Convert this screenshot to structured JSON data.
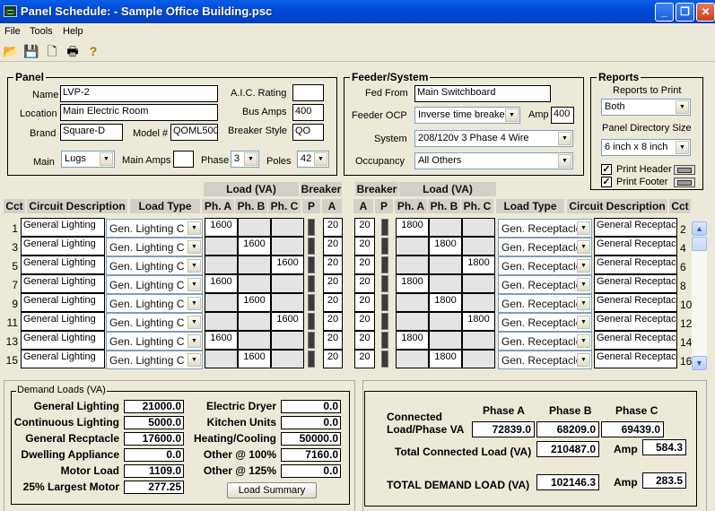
{
  "window": {
    "title": "Panel Schedule: -  Sample Office Building.psc",
    "minimize": "_",
    "restore": "❐",
    "close": "✕"
  },
  "menu": [
    "File",
    "Tools",
    "Help"
  ],
  "toolbar": {
    "icons": [
      "open-folder-icon",
      "save-icon",
      "print-preview-icon",
      "printer-icon",
      "help-icon"
    ],
    "glyphs": [
      "📂",
      "💾",
      "🗋",
      "🖶",
      "?"
    ]
  },
  "panel": {
    "title": "Panel",
    "name_label": "Name",
    "name": "LVP-2",
    "location_label": "Location",
    "location": "Main Electric Room",
    "brand_label": "Brand",
    "brand": "Square-D",
    "model_label": "Model #",
    "model": "QOML500",
    "aic_label": "A.I.C. Rating",
    "aic": "",
    "bus_label": "Bus Amps",
    "bus_amps": "400",
    "style_label": "Breaker Style",
    "breaker_style": "QO",
    "main_label": "Main",
    "main": "Lugs",
    "main_amps_label": "Main Amps",
    "main_amps": "",
    "phase_label": "Phase",
    "phase": "3",
    "poles_label": "Poles",
    "poles": "42"
  },
  "feeder": {
    "title": "Feeder/System",
    "fed_from_label": "Fed From",
    "fed_from": "Main Switchboard",
    "ocp_label": "Feeder OCP",
    "ocp": "Inverse time breaker",
    "amp_label": "Amp",
    "amp": "400",
    "system_label": "System",
    "system": "208/120v 3 Phase 4 Wire",
    "occupancy_label": "Occupancy",
    "occupancy": "All Others"
  },
  "reports": {
    "title": "Reports",
    "to_print_label": "Reports to Print",
    "to_print": "Both",
    "dir_size_label": "Panel Directory Size",
    "dir_size": "6 inch x 8 inch",
    "print_header": "Print Header",
    "print_footer": "Print Footer",
    "header_checked": true,
    "footer_checked": true
  },
  "grid": {
    "group_left_load": "Load (VA)",
    "group_left_breaker": "Breaker",
    "group_right_breaker": "Breaker",
    "group_right_load": "Load (VA)",
    "headers_left": [
      "Cct",
      "Circuit Description",
      "Load Type",
      "Ph. A",
      "Ph. B",
      "Ph. C",
      "P",
      "A"
    ],
    "headers_right": [
      "A",
      "P",
      "Ph. A",
      "Ph. B",
      "Ph. C",
      "Load Type",
      "Circuit Description",
      "Cct"
    ],
    "rows": [
      {
        "lc": "1",
        "ldesc": "General Lighting",
        "ltype": "Gen. Lighting C",
        "la": "1600",
        "lb": "",
        "lcc": "",
        "lamp": "20",
        "ramp": "20",
        "ra": "1800",
        "rb": "",
        "rc": "",
        "rtype": "Gen. Receptacle",
        "rdesc": "General Receptacl",
        "rcct": "2"
      },
      {
        "lc": "3",
        "ldesc": "General Lighting",
        "ltype": "Gen. Lighting C",
        "la": "",
        "lb": "1600",
        "lcc": "",
        "lamp": "20",
        "ramp": "20",
        "ra": "",
        "rb": "1800",
        "rc": "",
        "rtype": "Gen. Receptacle",
        "rdesc": "General Receptacl",
        "rcct": "4"
      },
      {
        "lc": "5",
        "ldesc": "General Lighting",
        "ltype": "Gen. Lighting C",
        "la": "",
        "lb": "",
        "lcc": "1600",
        "lamp": "20",
        "ramp": "20",
        "ra": "",
        "rb": "",
        "rc": "1800",
        "rtype": "Gen. Receptacle",
        "rdesc": "General Receptacl",
        "rcct": "6"
      },
      {
        "lc": "7",
        "ldesc": "General Lighting",
        "ltype": "Gen. Lighting C",
        "la": "1600",
        "lb": "",
        "lcc": "",
        "lamp": "20",
        "ramp": "20",
        "ra": "1800",
        "rb": "",
        "rc": "",
        "rtype": "Gen. Receptacle",
        "rdesc": "General Receptacl",
        "rcct": "8"
      },
      {
        "lc": "9",
        "ldesc": "General Lighting",
        "ltype": "Gen. Lighting C",
        "la": "",
        "lb": "1600",
        "lcc": "",
        "lamp": "20",
        "ramp": "20",
        "ra": "",
        "rb": "1800",
        "rc": "",
        "rtype": "Gen. Receptacle",
        "rdesc": "General Receptacl",
        "rcct": "10"
      },
      {
        "lc": "11",
        "ldesc": "General Lighting",
        "ltype": "Gen. Lighting C",
        "la": "",
        "lb": "",
        "lcc": "1600",
        "lamp": "20",
        "ramp": "20",
        "ra": "",
        "rb": "",
        "rc": "1800",
        "rtype": "Gen. Receptacle",
        "rdesc": "General Receptacl",
        "rcct": "12"
      },
      {
        "lc": "13",
        "ldesc": "General Lighting",
        "ltype": "Gen. Lighting C",
        "la": "1600",
        "lb": "",
        "lcc": "",
        "lamp": "20",
        "ramp": "20",
        "ra": "1800",
        "rb": "",
        "rc": "",
        "rtype": "Gen. Receptacle",
        "rdesc": "General Receptacl",
        "rcct": "14"
      },
      {
        "lc": "15",
        "ldesc": "General Lighting",
        "ltype": "Gen. Lighting C",
        "la": "",
        "lb": "1600",
        "lcc": "",
        "lamp": "20",
        "ramp": "20",
        "ra": "",
        "rb": "1800",
        "rc": "",
        "rtype": "Gen. Receptacle",
        "rdesc": "General Receptacl",
        "rcct": "16"
      }
    ]
  },
  "demand": {
    "title": "Demand Loads (VA)",
    "left": [
      {
        "label": "General Lighting",
        "value": "21000.0"
      },
      {
        "label": "Continuous Lighting",
        "value": "5000.0"
      },
      {
        "label": "General  Recptacle",
        "value": "17600.0"
      },
      {
        "label": "Dwelling Appliance",
        "value": "0.0"
      },
      {
        "label": "Motor Load",
        "value": "1109.0"
      },
      {
        "label": "25% Largest Motor",
        "value": "277.25"
      }
    ],
    "right": [
      {
        "label": "Electric Dryer",
        "value": "0.0"
      },
      {
        "label": "Kitchen Units",
        "value": "0.0"
      },
      {
        "label": "Heating/Cooling",
        "value": "50000.0"
      },
      {
        "label": "Other @ 100%",
        "value": "7160.0"
      },
      {
        "label": "Other @ 125%",
        "value": "0.0"
      }
    ],
    "load_summary_button": "Load Summary"
  },
  "totals": {
    "connected_label": "Connected\nLoad/Phase VA",
    "connected_label_1": "Connected",
    "connected_label_2": "Load/Phase VA",
    "phase_a_label": "Phase A",
    "phase_b_label": "Phase B",
    "phase_c_label": "Phase C",
    "phase_a": "72839.0",
    "phase_b": "68209.0",
    "phase_c": "69439.0",
    "total_connected_label": "Total Connected Load (VA)",
    "total_connected": "210487.0",
    "amp_label": "Amp",
    "connected_amp": "584.3",
    "total_demand_label": "TOTAL DEMAND LOAD (VA)",
    "total_demand": "102146.3",
    "demand_amp": "283.5"
  }
}
